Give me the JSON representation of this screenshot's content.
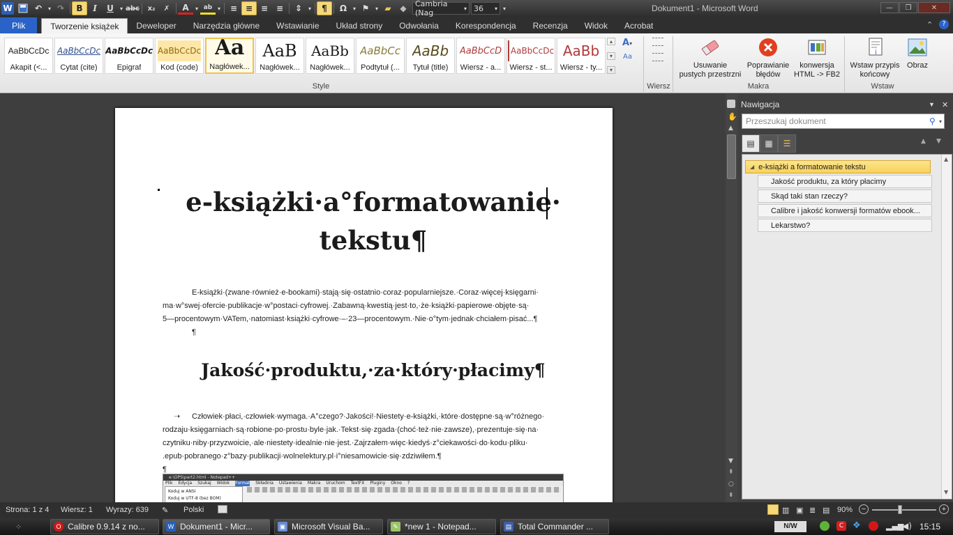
{
  "window": {
    "title": "Dokument1 - Microsoft Word"
  },
  "qat": {
    "font_name": "Cambria (Nag",
    "font_size": "36"
  },
  "tabs": [
    {
      "label": "Plik"
    },
    {
      "label": "Tworzenie książek"
    },
    {
      "label": "Deweloper"
    },
    {
      "label": "Narzędzia główne"
    },
    {
      "label": "Wstawianie"
    },
    {
      "label": "Układ strony"
    },
    {
      "label": "Odwołania"
    },
    {
      "label": "Korespondencja"
    },
    {
      "label": "Recenzja"
    },
    {
      "label": "Widok"
    },
    {
      "label": "Acrobat"
    }
  ],
  "styles": [
    {
      "preview": "AaBbCcDc",
      "name": "Akapit (<..."
    },
    {
      "preview": "AaBbCcDc",
      "name": "Cytat (cite)"
    },
    {
      "preview": "AaBbCcDc",
      "name": "Epigraf"
    },
    {
      "preview": "AaBbCcDc",
      "name": "Kod (code)"
    },
    {
      "preview": "Aa",
      "name": "Nagłówek..."
    },
    {
      "preview": "AaB",
      "name": "Nagłówek..."
    },
    {
      "preview": "AaBb",
      "name": "Nagłówek..."
    },
    {
      "preview": "AaBbCc",
      "name": "Podtytuł (..."
    },
    {
      "preview": "AaBb",
      "name": "Tytuł (title)"
    },
    {
      "preview": "AaBbCcD",
      "name": "Wiersz - a..."
    },
    {
      "preview": "AaBbCcDc",
      "name": "Wiersz - st..."
    },
    {
      "preview": "AaBb",
      "name": "Wiersz - ty..."
    }
  ],
  "groups": {
    "style": "Style",
    "wiersz": "Wiersz",
    "makra": "Makra",
    "wstaw": "Wstaw"
  },
  "macros": {
    "usuwanie_l1": "Usuwanie",
    "usuwanie_l2": "pustych przestrzni",
    "poprawianie_l1": "Poprawianie",
    "poprawianie_l2": "błędów",
    "konwersja_l1": "konwersja",
    "konwersja_l2": "HTML -> FB2"
  },
  "wstaw": {
    "przypis_l1": "Wstaw przypis",
    "przypis_l2": "końcowy",
    "obraz": "Obraz"
  },
  "document": {
    "title_l1": "e-książki·a°formatowanie·",
    "title_l2": "tekstu¶",
    "para1": [
      "E-książki·(zwane·również·e-bookami)·stają·się·ostatnio·coraz·popularniejsze.·Coraz·więcej·księgarni·",
      "ma·w°swej·ofercie·publikacje·w°postaci·cyfrowej.·Zabawną·kwestią·jest·to,·że·książki·papierowe·objęte·są·",
      "5—procentowym·VATem,·natomiast·książki·cyfrowe·–·23—procentowym.·Nie·o°tym·jednak·chciałem·pisać...¶"
    ],
    "empty_para": "¶",
    "heading2": "Jakość·produktu,·za·który·płacimy¶",
    "para2": [
      "Człowiek·płaci,·człowiek·wymaga.·A°czego?·Jakości!·Niestety·e-książki,·które·dostępne·są·w°różnego·",
      "rodzaju·księgarniach·są·robione·po·prostu·byle·jak.·Tekst·się·zgada·(choć·też·nie·zawsze),·prezentuje·się·na·",
      "czytniku·niby·przyzwoicie,·ale·niestety·idealnie·nie·jest.·Zajrzałem·więc·kiedyś·z°ciekawości·do·kodu·pliku·",
      ".epub·pobranego·z°bazy·publikacji·wolnelektury.pl·i°niesamowicie·się·zdziwiłem.¶"
    ],
    "empty_para2": "¶",
    "embedded": {
      "title": "e:\\OPS\\part2.html - Notepad++",
      "menu": [
        "Plik",
        "Edycja",
        "Szukaj",
        "Widok",
        "Format",
        "Składnia",
        "Ustawienia",
        "Makra",
        "Uruchom",
        "TextFX",
        "Pluginy",
        "Okno",
        "?"
      ],
      "drop1": "Koduj w ANSI",
      "drop2": "Koduj w UTF-8 (bez BOM)"
    }
  },
  "navigation": {
    "header": "Nawigacja",
    "search_placeholder": "Przeszukaj dokument",
    "items": [
      "e-książki a formatowanie tekstu",
      "Jakość produktu, za który płacimy",
      "Skąd taki stan rzeczy?",
      "Calibre i jakość konwersji formatów ebook...",
      "Lekarstwo?"
    ]
  },
  "status": {
    "page": "Strona: 1 z 4",
    "line": "Wiersz: 1",
    "words": "Wyrazy: 639",
    "language": "Polski",
    "zoom": "90%"
  },
  "taskbar": {
    "items": [
      "Calibre 0.9.14 z no...",
      "Dokument1 - Micr...",
      "Microsoft Visual Ba...",
      "*new  1 - Notepad...",
      "Total Commander ..."
    ],
    "lang": "N/W",
    "time": "15:15"
  },
  "colors": {
    "accent_blue": "#2a63c8",
    "selection_yellow": "#f7d25d",
    "error_red": "#e0401f"
  }
}
